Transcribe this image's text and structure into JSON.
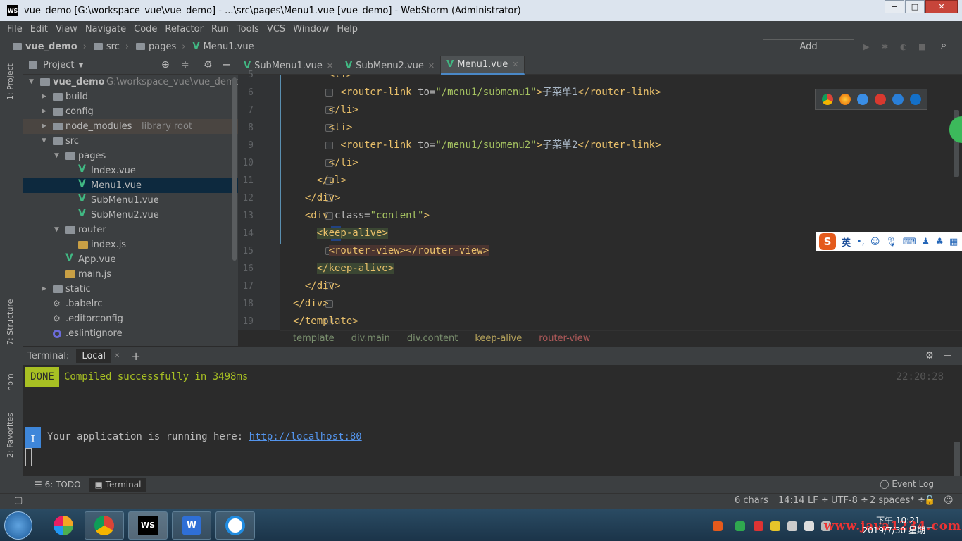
{
  "window": {
    "title": "vue_demo [G:\\workspace_vue\\vue_demo] - ...\\src\\pages\\Menu1.vue [vue_demo] - WebStorm (Administrator)",
    "app_icon": "WS",
    "minimize": "−",
    "maximize": "□",
    "close": "✕"
  },
  "menu": [
    "File",
    "Edit",
    "View",
    "Navigate",
    "Code",
    "Refactor",
    "Run",
    "Tools",
    "VCS",
    "Window",
    "Help"
  ],
  "navbar": {
    "crumbs": [
      "vue_demo",
      "src",
      "pages",
      "Menu1.vue"
    ],
    "add_configuration": "Add Configuration..."
  },
  "left_strip": {
    "project": "1: Project",
    "structure": "7: Structure",
    "npm": "npm",
    "favorites": "2: Favorites"
  },
  "project_panel": {
    "title": "Project",
    "tree": [
      {
        "label": "vue_demo",
        "hint": "G:\\workspace_vue\\vue_demo",
        "type": "folder",
        "depth": 0,
        "arrow": "▼"
      },
      {
        "label": "build",
        "type": "folder",
        "depth": 1,
        "arrow": "▶"
      },
      {
        "label": "config",
        "type": "folder",
        "depth": 1,
        "arrow": "▶"
      },
      {
        "label": "node_modules",
        "hint": "library root",
        "type": "folder",
        "depth": 1,
        "arrow": "▶"
      },
      {
        "label": "src",
        "type": "folder",
        "depth": 1,
        "arrow": "▼"
      },
      {
        "label": "pages",
        "type": "folder",
        "depth": 2,
        "arrow": "▼"
      },
      {
        "label": "Index.vue",
        "type": "vue",
        "depth": 3
      },
      {
        "label": "Menu1.vue",
        "type": "vue",
        "depth": 3
      },
      {
        "label": "SubMenu1.vue",
        "type": "vue",
        "depth": 3
      },
      {
        "label": "SubMenu2.vue",
        "type": "vue",
        "depth": 3
      },
      {
        "label": "router",
        "type": "folder",
        "depth": 2,
        "arrow": "▼"
      },
      {
        "label": "index.js",
        "type": "js",
        "depth": 3
      },
      {
        "label": "App.vue",
        "type": "vue",
        "depth": 2
      },
      {
        "label": "main.js",
        "type": "js",
        "depth": 2
      },
      {
        "label": "static",
        "type": "folder",
        "depth": 1,
        "arrow": "▶"
      },
      {
        "label": ".babelrc",
        "type": "gear",
        "depth": 1
      },
      {
        "label": ".editorconfig",
        "type": "gear",
        "depth": 1
      },
      {
        "label": ".eslintignore",
        "type": "circle",
        "depth": 1
      }
    ]
  },
  "editor": {
    "tabs": [
      {
        "label": "SubMenu1.vue",
        "active": false
      },
      {
        "label": "SubMenu2.vue",
        "active": false
      },
      {
        "label": "Menu1.vue",
        "active": true
      }
    ],
    "lines": [
      {
        "n": "5",
        "indent": "      ",
        "parts": [
          [
            "tag",
            "<li>"
          ]
        ]
      },
      {
        "n": "6",
        "indent": "        ",
        "parts": [
          [
            "tag",
            "<router-link "
          ],
          [
            "at",
            "to="
          ],
          [
            "val",
            "\"/menu1/submenu1\""
          ],
          [
            "tag",
            ">"
          ],
          [
            "tx",
            "子菜单1"
          ],
          [
            "tag",
            "</router-link>"
          ]
        ]
      },
      {
        "n": "7",
        "indent": "      ",
        "parts": [
          [
            "tag",
            "</li>"
          ]
        ]
      },
      {
        "n": "8",
        "indent": "      ",
        "parts": [
          [
            "tag",
            "<li>"
          ]
        ]
      },
      {
        "n": "9",
        "indent": "        ",
        "parts": [
          [
            "tag",
            "<router-link "
          ],
          [
            "at",
            "to="
          ],
          [
            "val",
            "\"/menu1/submenu2\""
          ],
          [
            "tag",
            ">"
          ],
          [
            "tx",
            "子菜单2"
          ],
          [
            "tag",
            "</router-link>"
          ]
        ]
      },
      {
        "n": "10",
        "indent": "      ",
        "parts": [
          [
            "tag",
            "</li>"
          ]
        ]
      },
      {
        "n": "11",
        "indent": "    ",
        "parts": [
          [
            "tag",
            "</ul>"
          ]
        ]
      },
      {
        "n": "12",
        "indent": "  ",
        "parts": [
          [
            "tag",
            "</div>"
          ]
        ]
      },
      {
        "n": "13",
        "indent": "  ",
        "parts": [
          [
            "tag",
            "<div "
          ],
          [
            "at",
            "class="
          ],
          [
            "val",
            "\"content\""
          ],
          [
            "tag",
            ">"
          ]
        ]
      },
      {
        "n": "14",
        "indent": "    ",
        "parts": [
          [
            "tag",
            "<keep-alive>"
          ]
        ]
      },
      {
        "n": "15",
        "indent": "      ",
        "parts": [
          [
            "tag",
            "<router-view></router-view>"
          ]
        ]
      },
      {
        "n": "16",
        "indent": "    ",
        "parts": [
          [
            "tag",
            "</keep-alive>"
          ]
        ]
      },
      {
        "n": "17",
        "indent": "  ",
        "parts": [
          [
            "tag",
            "</div>"
          ]
        ]
      },
      {
        "n": "18",
        "indent": "",
        "parts": [
          [
            "tag",
            "</div>"
          ]
        ]
      },
      {
        "n": "19",
        "indent": "",
        "parts": [
          [
            "tag",
            "</template>"
          ]
        ]
      }
    ],
    "breadcrumbs": [
      "template",
      "div.main",
      "div.content",
      "keep-alive",
      "router-view"
    ]
  },
  "ime": {
    "logo": "S",
    "lang": "英"
  },
  "terminal": {
    "label": "Terminal:",
    "tab": "Local",
    "add": "+",
    "done_badge": "DONE",
    "compiled": "Compiled successfully in 3498ms",
    "time": "22:20:28",
    "info_badge": "I",
    "running_prefix": "Your application is running here: ",
    "running_link": "http://localhost:80"
  },
  "bottom_tabs": {
    "todo": "6: TODO",
    "terminal": "Terminal",
    "event_log": "Event Log"
  },
  "status": {
    "chars": "6 chars",
    "pos": "14:14",
    "lf": "LF ÷",
    "enc": "UTF-8 ÷",
    "spaces": "2 spaces* ÷"
  },
  "taskbar": {
    "clock_time": "下午 10:21",
    "clock_date": "2019/7/30 星期二",
    "watermark": "www.java1234.com"
  },
  "colors": {
    "accent": "#4a88c7",
    "vue_green": "#41b883",
    "done_bg": "#a8c023"
  }
}
